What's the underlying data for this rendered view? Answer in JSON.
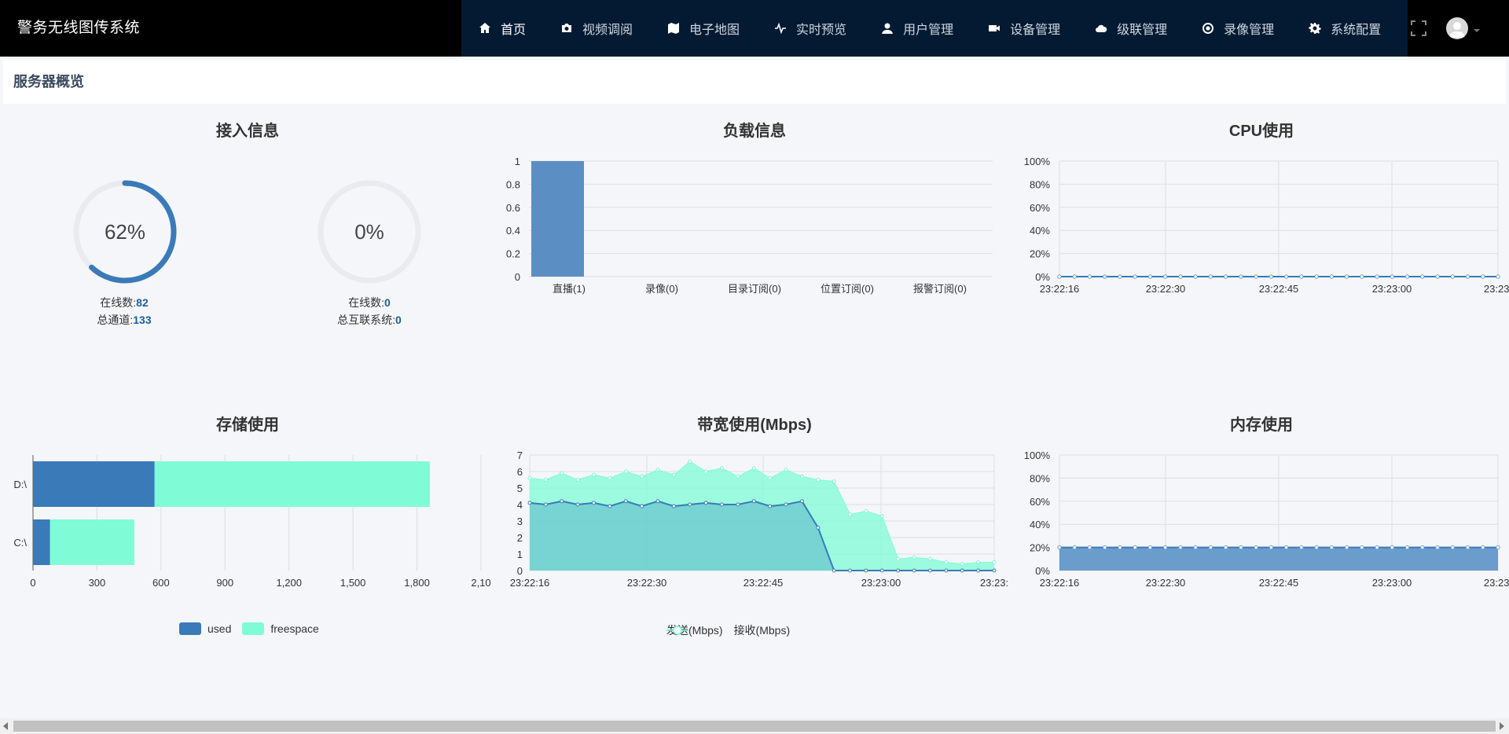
{
  "app": {
    "title": "警务无线图传系统"
  },
  "nav": [
    {
      "label": "首页",
      "icon": "home-icon",
      "active": true
    },
    {
      "label": "视频调阅",
      "icon": "camera-icon"
    },
    {
      "label": "电子地图",
      "icon": "map-icon"
    },
    {
      "label": "实时预览",
      "icon": "pulse-icon"
    },
    {
      "label": "用户管理",
      "icon": "user-icon"
    },
    {
      "label": "设备管理",
      "icon": "video-camera-icon"
    },
    {
      "label": "级联管理",
      "icon": "cloud-icon"
    },
    {
      "label": "录像管理",
      "icon": "record-icon"
    },
    {
      "label": "系统配置",
      "icon": "gear-icon"
    }
  ],
  "page": {
    "title": "服务器概览"
  },
  "panels": {
    "access": {
      "title": "接入信息",
      "gauges": [
        {
          "value_text": "62%",
          "percent": 62,
          "line1_label": "在线数:",
          "line1_value": "82",
          "line2_label": "总通道:",
          "line2_value": "133"
        },
        {
          "value_text": "0%",
          "percent": 0,
          "line1_label": "在线数:",
          "line1_value": "0",
          "line2_label": "总互联系统:",
          "line2_value": "0"
        }
      ]
    },
    "load": {
      "title": "负载信息"
    },
    "cpu": {
      "title": "CPU使用"
    },
    "storage": {
      "title": "存储使用"
    },
    "bandwidth": {
      "title": "带宽使用(Mbps)"
    },
    "memory": {
      "title": "内存使用"
    }
  },
  "colors": {
    "primary": "#3a7ab8",
    "mint": "#7ffcd6",
    "nav_bg": "#041a33",
    "grid": "#dcdfe6"
  },
  "chart_data": [
    {
      "id": "load",
      "type": "bar",
      "categories": [
        "直播(1)",
        "录像(0)",
        "目录订阅(0)",
        "位置订阅(0)",
        "报警订阅(0)"
      ],
      "values": [
        1,
        0,
        0,
        0,
        0
      ],
      "ylim": [
        0,
        1
      ],
      "yticks": [
        "0",
        "0.2",
        "0.4",
        "0.6",
        "0.8",
        "1"
      ],
      "color": "#5b8fc4"
    },
    {
      "id": "cpu",
      "type": "line",
      "x": [
        "23:22:16",
        "23:22:30",
        "23:22:45",
        "23:23:00",
        "23:23:"
      ],
      "values": [
        0,
        0,
        0,
        0,
        0,
        0,
        0,
        0,
        0,
        0,
        0,
        0,
        0,
        0,
        0,
        0,
        0,
        0,
        0,
        0,
        0,
        0,
        0,
        0,
        0,
        0,
        0,
        0,
        0,
        0
      ],
      "ylim": [
        0,
        100
      ],
      "yticks": [
        "0%",
        "20%",
        "40%",
        "60%",
        "80%",
        "100%"
      ]
    },
    {
      "id": "storage",
      "type": "bar",
      "orientation": "horizontal",
      "stacked": true,
      "categories": [
        "D:\\",
        "C:\\"
      ],
      "series": [
        {
          "name": "used",
          "values": [
            570,
            80
          ],
          "color": "#3a7ab8"
        },
        {
          "name": "freespace",
          "values": [
            1290,
            395
          ],
          "color": "#7ffcd6"
        }
      ],
      "xlim": [
        0,
        2100
      ],
      "xticks": [
        "0",
        "300",
        "600",
        "900",
        "1,200",
        "1,500",
        "1,800",
        "2,10"
      ]
    },
    {
      "id": "bandwidth",
      "type": "area",
      "x": [
        "23:22:16",
        "23:22:30",
        "23:22:45",
        "23:23:00",
        "23:23:"
      ],
      "ylim": [
        0,
        7
      ],
      "yticks": [
        "0",
        "1",
        "2",
        "3",
        "4",
        "5",
        "6",
        "7"
      ],
      "series": [
        {
          "name": "发送(Mbps)",
          "values": [
            4.1,
            4.0,
            4.2,
            4.0,
            4.1,
            3.9,
            4.2,
            3.9,
            4.2,
            3.9,
            4.0,
            4.1,
            4.0,
            4.0,
            4.2,
            3.9,
            4.0,
            4.2,
            2.6,
            0,
            0,
            0,
            0,
            0,
            0,
            0,
            0,
            0,
            0,
            0
          ]
        },
        {
          "name": "接收(Mbps)",
          "values": [
            5.6,
            5.5,
            5.9,
            5.5,
            5.8,
            5.6,
            6.0,
            5.7,
            6.1,
            5.8,
            6.6,
            6.0,
            6.2,
            5.7,
            6.2,
            5.6,
            6.1,
            5.7,
            5.5,
            5.4,
            3.4,
            3.6,
            3.3,
            0.7,
            0.8,
            0.7,
            0.5,
            0.4,
            0.5,
            0.5
          ]
        }
      ]
    },
    {
      "id": "memory",
      "type": "area",
      "x": [
        "23:22:16",
        "23:22:30",
        "23:22:45",
        "23:23:00",
        "23:23:"
      ],
      "values": [
        20,
        20,
        20,
        20,
        20,
        20,
        20,
        20,
        20,
        20,
        20,
        20,
        20,
        20,
        20,
        20,
        20,
        20,
        20,
        20,
        20,
        20,
        20,
        20,
        20,
        20,
        20,
        20,
        20,
        20
      ],
      "ylim": [
        0,
        100
      ],
      "yticks": [
        "0%",
        "20%",
        "40%",
        "60%",
        "80%",
        "100%"
      ]
    }
  ]
}
